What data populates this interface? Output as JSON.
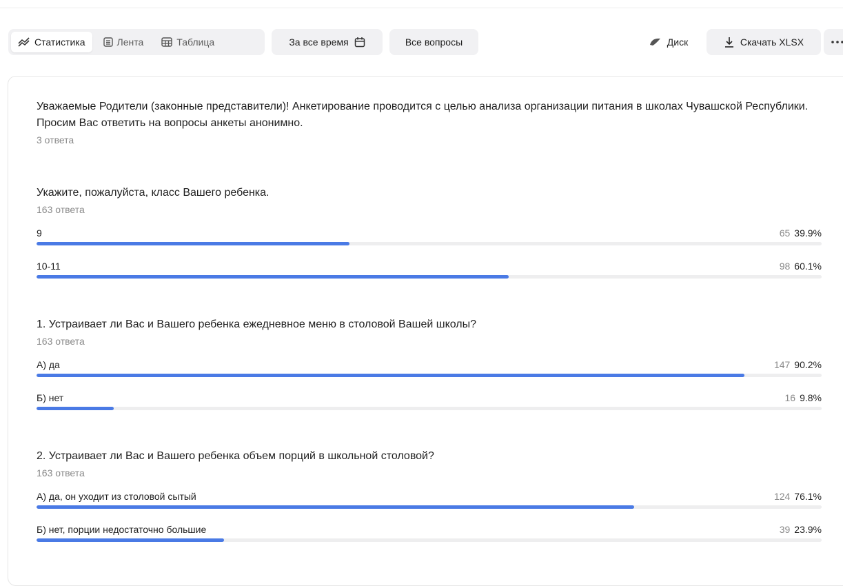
{
  "toolbar": {
    "tabs": [
      {
        "label": "Статистика",
        "icon": "chart-lines-icon",
        "active": true
      },
      {
        "label": "Лента",
        "icon": "feed-icon",
        "active": false
      },
      {
        "label": "Таблица",
        "icon": "table-icon",
        "active": false
      }
    ],
    "period_label": "За все время",
    "questions_label": "Все вопросы",
    "disk_label": "Диск",
    "download_label": "Скачать XLSX",
    "accent": "#4a7ae5"
  },
  "intro": {
    "text": "Уважаемые Родители (законные представители)! Анкетирование проводится с целью анализа организации питания в школах Чувашской Республики. Просим Вас ответить на вопросы анкеты анонимно.",
    "count": "3 ответа"
  },
  "questions": [
    {
      "title": "Укажите, пожалуйста, класс Вашего ребенка.",
      "count": "163 ответа",
      "options": [
        {
          "label": "9",
          "num": "65",
          "pct": "39.9%",
          "value": 39.9
        },
        {
          "label": "10-11",
          "num": "98",
          "pct": "60.1%",
          "value": 60.1
        }
      ]
    },
    {
      "title": "1. Устраивает ли Вас и Вашего ребенка ежедневное меню в столовой Вашей школы?",
      "count": "163 ответа",
      "options": [
        {
          "label": "А) да",
          "num": "147",
          "pct": "90.2%",
          "value": 90.2
        },
        {
          "label": "Б) нет",
          "num": "16",
          "pct": "9.8%",
          "value": 9.8
        }
      ]
    },
    {
      "title": "2. Устраивает ли Вас и Вашего ребенка объем порций в школьной столовой?",
      "count": "163 ответа",
      "options": [
        {
          "label": "А) да, он уходит из столовой сытый",
          "num": "124",
          "pct": "76.1%",
          "value": 76.1
        },
        {
          "label": "Б) нет, порции недостаточно большие",
          "num": "39",
          "pct": "23.9%",
          "value": 23.9
        }
      ]
    }
  ]
}
